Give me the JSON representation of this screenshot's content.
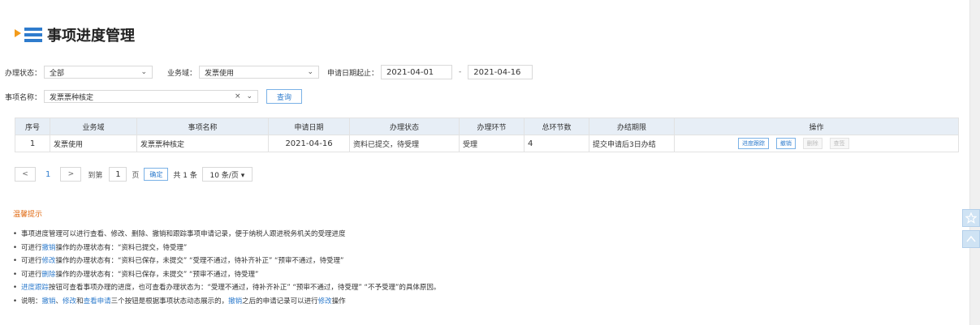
{
  "page": {
    "title": "事项进度管理"
  },
  "filters": {
    "status_label": "办理状态：",
    "status_value": "全部",
    "domain_label": "业务域：",
    "domain_value": "发票使用",
    "date_label": "申请日期起止：",
    "date_from": "2021-04-01",
    "date_sep": "-",
    "date_to": "2021-04-16",
    "item_label": "事项名称：",
    "item_value": "发票票种核定",
    "clear_glyph": "×",
    "query_label": "查询"
  },
  "table": {
    "headers": [
      "序号",
      "业务域",
      "事项名称",
      "申请日期",
      "办理状态",
      "办理环节",
      "总环节数",
      "办结期限",
      "操作"
    ],
    "rows": [
      {
        "index": "1",
        "domain": "发票使用",
        "item": "发票票种核定",
        "date": "2021-04-16",
        "status": "资料已提交，待受理",
        "stage": "受理",
        "total": "4",
        "deadline": "提交申请后3日办结",
        "actions": [
          "进度跟踪",
          "撤销",
          "删除",
          "查签"
        ]
      }
    ]
  },
  "pager": {
    "prev": "<",
    "page": "1",
    "next": ">",
    "goto_label": "到第",
    "goto_value": "1",
    "page_unit": "页",
    "confirm": "确定",
    "total": "共 1 条",
    "page_size": "10 条/页 ▾"
  },
  "tips": {
    "title": "温馨提示",
    "items": [
      {
        "parts": [
          {
            "t": "事项进度管理可以进行查看、修改、删除、撤销和跟踪事项申请记录，便于纳税人跟进税务机关的受理进度",
            "hl": false
          }
        ]
      },
      {
        "parts": [
          {
            "t": "可进行",
            "hl": false
          },
          {
            "t": "撤销",
            "hl": true
          },
          {
            "t": "操作的办理状态有：“资料已提交，待受理”",
            "hl": false
          }
        ]
      },
      {
        "parts": [
          {
            "t": "可进行",
            "hl": false
          },
          {
            "t": "修改",
            "hl": true
          },
          {
            "t": "操作的办理状态有：“资料已保存，未提交” “受理不通过，待补齐补正” “预审不通过，待受理”",
            "hl": false
          }
        ]
      },
      {
        "parts": [
          {
            "t": "可进行",
            "hl": false
          },
          {
            "t": "删除",
            "hl": true
          },
          {
            "t": "操作的办理状态有：“资料已保存，未提交” “预审不通过，待受理”",
            "hl": false
          }
        ]
      },
      {
        "parts": [
          {
            "t": "进度跟踪",
            "hl": true
          },
          {
            "t": "按钮可查看事项办理的进度，也可查看办理状态为：“受理不通过，待补齐补正” “预审不通过，待受理” “不予受理”的具体原因。",
            "hl": false
          }
        ]
      },
      {
        "parts": [
          {
            "t": "说明：",
            "hl": false
          },
          {
            "t": "撤销",
            "hl": true
          },
          {
            "t": "、",
            "hl": false
          },
          {
            "t": "修改",
            "hl": true
          },
          {
            "t": "和",
            "hl": false
          },
          {
            "t": "查看申请",
            "hl": true
          },
          {
            "t": "三个按钮是根据事项状态动态展示的，",
            "hl": false
          },
          {
            "t": "撤销",
            "hl": true
          },
          {
            "t": "之后的申请记录可以进行",
            "hl": false
          },
          {
            "t": "修改",
            "hl": true
          },
          {
            "t": "操作",
            "hl": false
          }
        ]
      }
    ]
  },
  "colors": {
    "accent": "#2f7ccd",
    "tip_title": "#e06a12",
    "header_bg": "#e7eef6"
  },
  "side_tools": [
    "star-icon",
    "chevron-up-icon"
  ]
}
